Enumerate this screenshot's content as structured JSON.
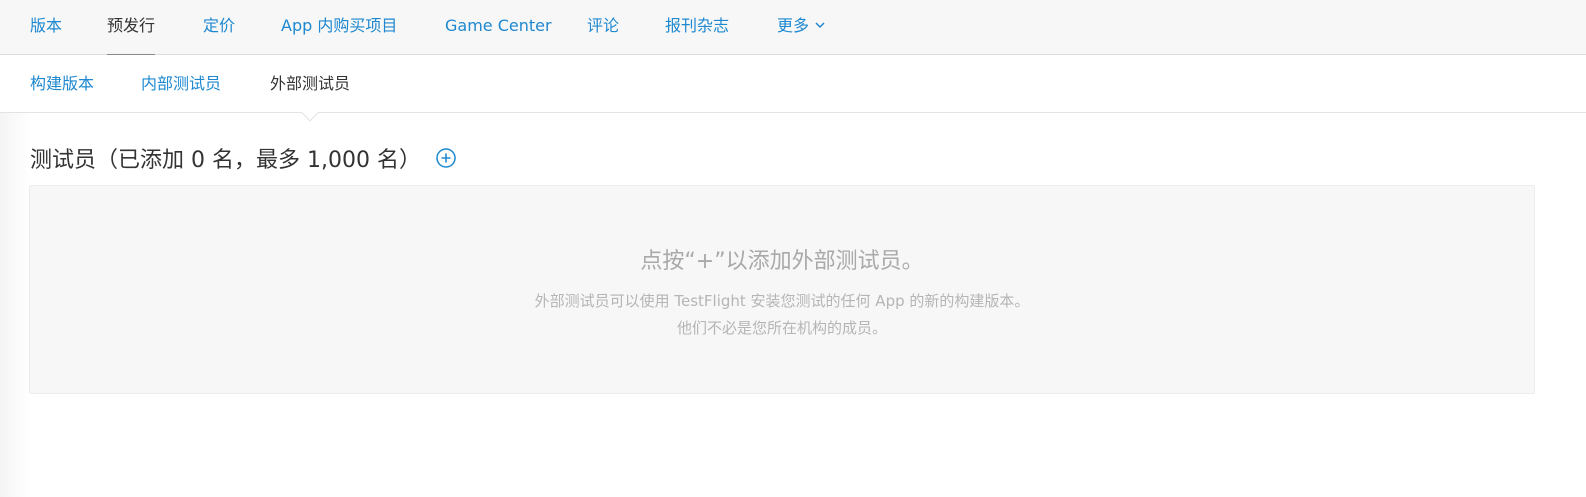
{
  "top_nav": {
    "tabs": [
      {
        "label": "版本"
      },
      {
        "label": "预发行"
      },
      {
        "label": "定价"
      },
      {
        "label": "App 内购买项目"
      },
      {
        "label": "Game Center"
      },
      {
        "label": "评论"
      },
      {
        "label": "报刊杂志"
      },
      {
        "label": "更多"
      }
    ],
    "active": "预发行"
  },
  "sub_nav": {
    "tabs": [
      {
        "label": "构建版本"
      },
      {
        "label": "内部测试员"
      },
      {
        "label": "外部测试员"
      }
    ],
    "active": "外部测试员"
  },
  "section": {
    "heading": "测试员（已添加 0 名，最多 1,000 名）",
    "add_icon": "plus-circle-icon"
  },
  "empty_state": {
    "title": "点按“+”以添加外部测试员。",
    "description_line1": "外部测试员可以使用 TestFlight 安装您测试的任何 App 的新的构建版本。",
    "description_line2": "他们不必是您所在机构的成员。"
  },
  "colors": {
    "link": "#1e88d0",
    "text": "#333333",
    "muted": "#a9a9a9",
    "panel_bg": "#f7f7f7"
  }
}
